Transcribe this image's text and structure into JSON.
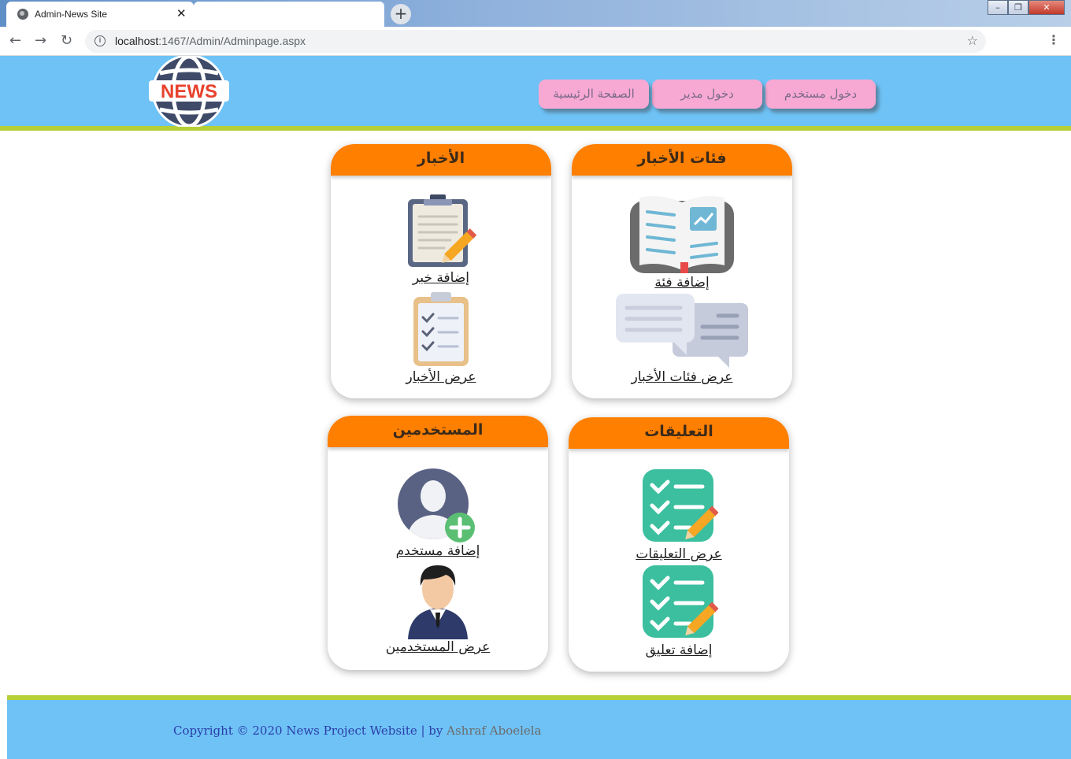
{
  "browser": {
    "tab_title": "Admin-News Site",
    "tab_close": "✕",
    "new_tab": "+",
    "url_host": "localhost",
    "url_path": ":1467/Admin/Adminpage.aspx",
    "window_buttons": {
      "minimize": "–",
      "restore": "❐",
      "close": "✕"
    }
  },
  "header": {
    "logo_text": "NEWS",
    "nav": [
      {
        "label": "دخول مستخدم"
      },
      {
        "label": "دخول مدير"
      },
      {
        "label": "الصفحة الرئيسية"
      }
    ]
  },
  "cards": {
    "categories": {
      "title": "فئات الأخبار",
      "items": [
        {
          "label": "إضافة فئة",
          "icon": "open-book-icon"
        },
        {
          "label": "عرض فئات الأخبار",
          "icon": "chat-bubbles-icon"
        }
      ]
    },
    "news": {
      "title": "الأخبار",
      "items": [
        {
          "label": "إضافة خبر",
          "icon": "clipboard-pencil-icon"
        },
        {
          "label": "عرض الأخبار",
          "icon": "checklist-clipboard-icon"
        }
      ]
    },
    "comments": {
      "title": "التعليقات",
      "items": [
        {
          "label": "عرض التعليقات",
          "icon": "checklist-pencil-icon"
        },
        {
          "label": "إضافة تعليق",
          "icon": "checklist-pencil-icon"
        }
      ]
    },
    "users": {
      "title": "المستخدمين",
      "items": [
        {
          "label": "إضافة مستخدم",
          "icon": "add-user-icon"
        },
        {
          "label": "عرض المستخدمين",
          "icon": "businessman-icon"
        }
      ]
    }
  },
  "footer": {
    "copyright": "Copyright © 2020 News Project Website | by ",
    "author": "Ashraf Aboelela"
  },
  "colors": {
    "header_bg": "#6ec2f6",
    "accent_rule": "#b5d136",
    "card_header": "#ff7f00",
    "nav_button": "#f7a9d3"
  }
}
